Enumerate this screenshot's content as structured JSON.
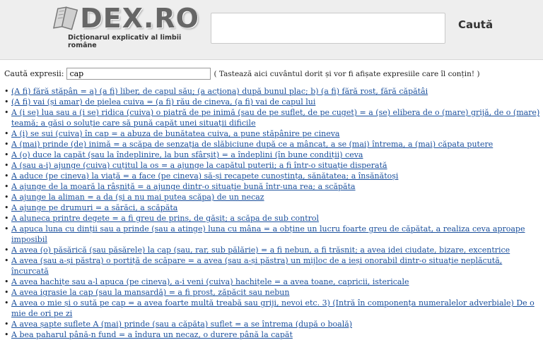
{
  "header": {
    "logo_text": "DEX.RO",
    "logo_subtitle": "Dicționarul explicativ al limbii române",
    "search_button": "Caută"
  },
  "filter": {
    "label": "Caută expresii:",
    "value": "cap",
    "hint": "( Tastează aici cuvântul dorit și vor fi afișate expresiile care îl conțin! )"
  },
  "expressions": [
    "(A fi) fără stăpân = a) (a fi) liber, de capul său; (a acționa) după bunul plac; b) (a fi) fără rost, fără căpătâi",
    "(A fi) vai (și amar) de pielea cuiva = (a fi) rău de cineva, (a fi) vai de capul lui",
    "A (i se) lua sau a (i se) ridica (cuiva) o piatră de pe inimă (sau de pe suflet, de pe cuget) = a (se) elibera de o (mare) grijă, de o (mare) teamă; a găsi o soluție care să pună capăt unei situații dificile",
    "A (i) se sui (cuiva) în cap = a abuza de bunătatea cuiva, a pune stăpânire pe cineva",
    "A (mai) prinde (de) inimă = a scăpa de senzația de slăbiciune după ce a mâncat, a se (mai) întrema, a (mai) căpata putere",
    "A (o) duce la capăt (sau la îndeplinire, la bun sfârșit) = a îndeplini (în bune condiții) ceva",
    "A (sau a-i) ajunge (cuiva) cuțitul la os = a ajunge la capătul puterii; a fi într-o situație disperată",
    "A aduce (pe cineva) la viață = a face (pe cineva) să-și recapete cunoștința, sănătatea; a însănătoși",
    "A ajunge de la moară la râșniță = a ajunge dintr-o situație bună într-una rea; a scăpăta",
    "A ajunge la aliman = a da (și a nu mai putea scăpa) de un necaz",
    "A ajunge pe drumuri = a sărăci, a scăpăta",
    "A aluneca printre degete = a fi greu de prins, de găsit; a scăpa de sub control",
    "A apuca luna cu dinții sau a prinde (sau a atinge) luna cu mâna = a obține un lucru foarte greu de căpătat, a realiza ceva aproape imposibil",
    "A avea (o) păsărică (sau păsărele) la cap (sau, rar, sub pălărie) = a fi nebun, a fi trăsnit; a avea idei ciudate, bizare, excentrice",
    "A avea (sau a-și păstra) o portiță de scăpare = a avea (sau a-și păstra) un mijloc de a ieși onorabil dintr-o situație neplăcută, încurcată",
    "A avea hachițe sau a-l apuca (pe cineva), a-i veni (cuiva) hachițele = a avea toane, capricii, istericale",
    "A avea igrasie la cap (sau la mansardă) = a fi prost, zăpăcit sau nebun",
    "A avea o mie și o sută pe cap = a avea foarte multă treabă sau griji, nevoi etc. 3) (Intră în componența numeralelor adverbiale) De o mie de ori pe zi",
    "A avea șapte suflete A (mai) prinde (sau a căpăta) suflet = a se întrema (după o boală)",
    "A bea paharul până-n fund = a îndura un necaz, o durere până la capăt"
  ]
}
